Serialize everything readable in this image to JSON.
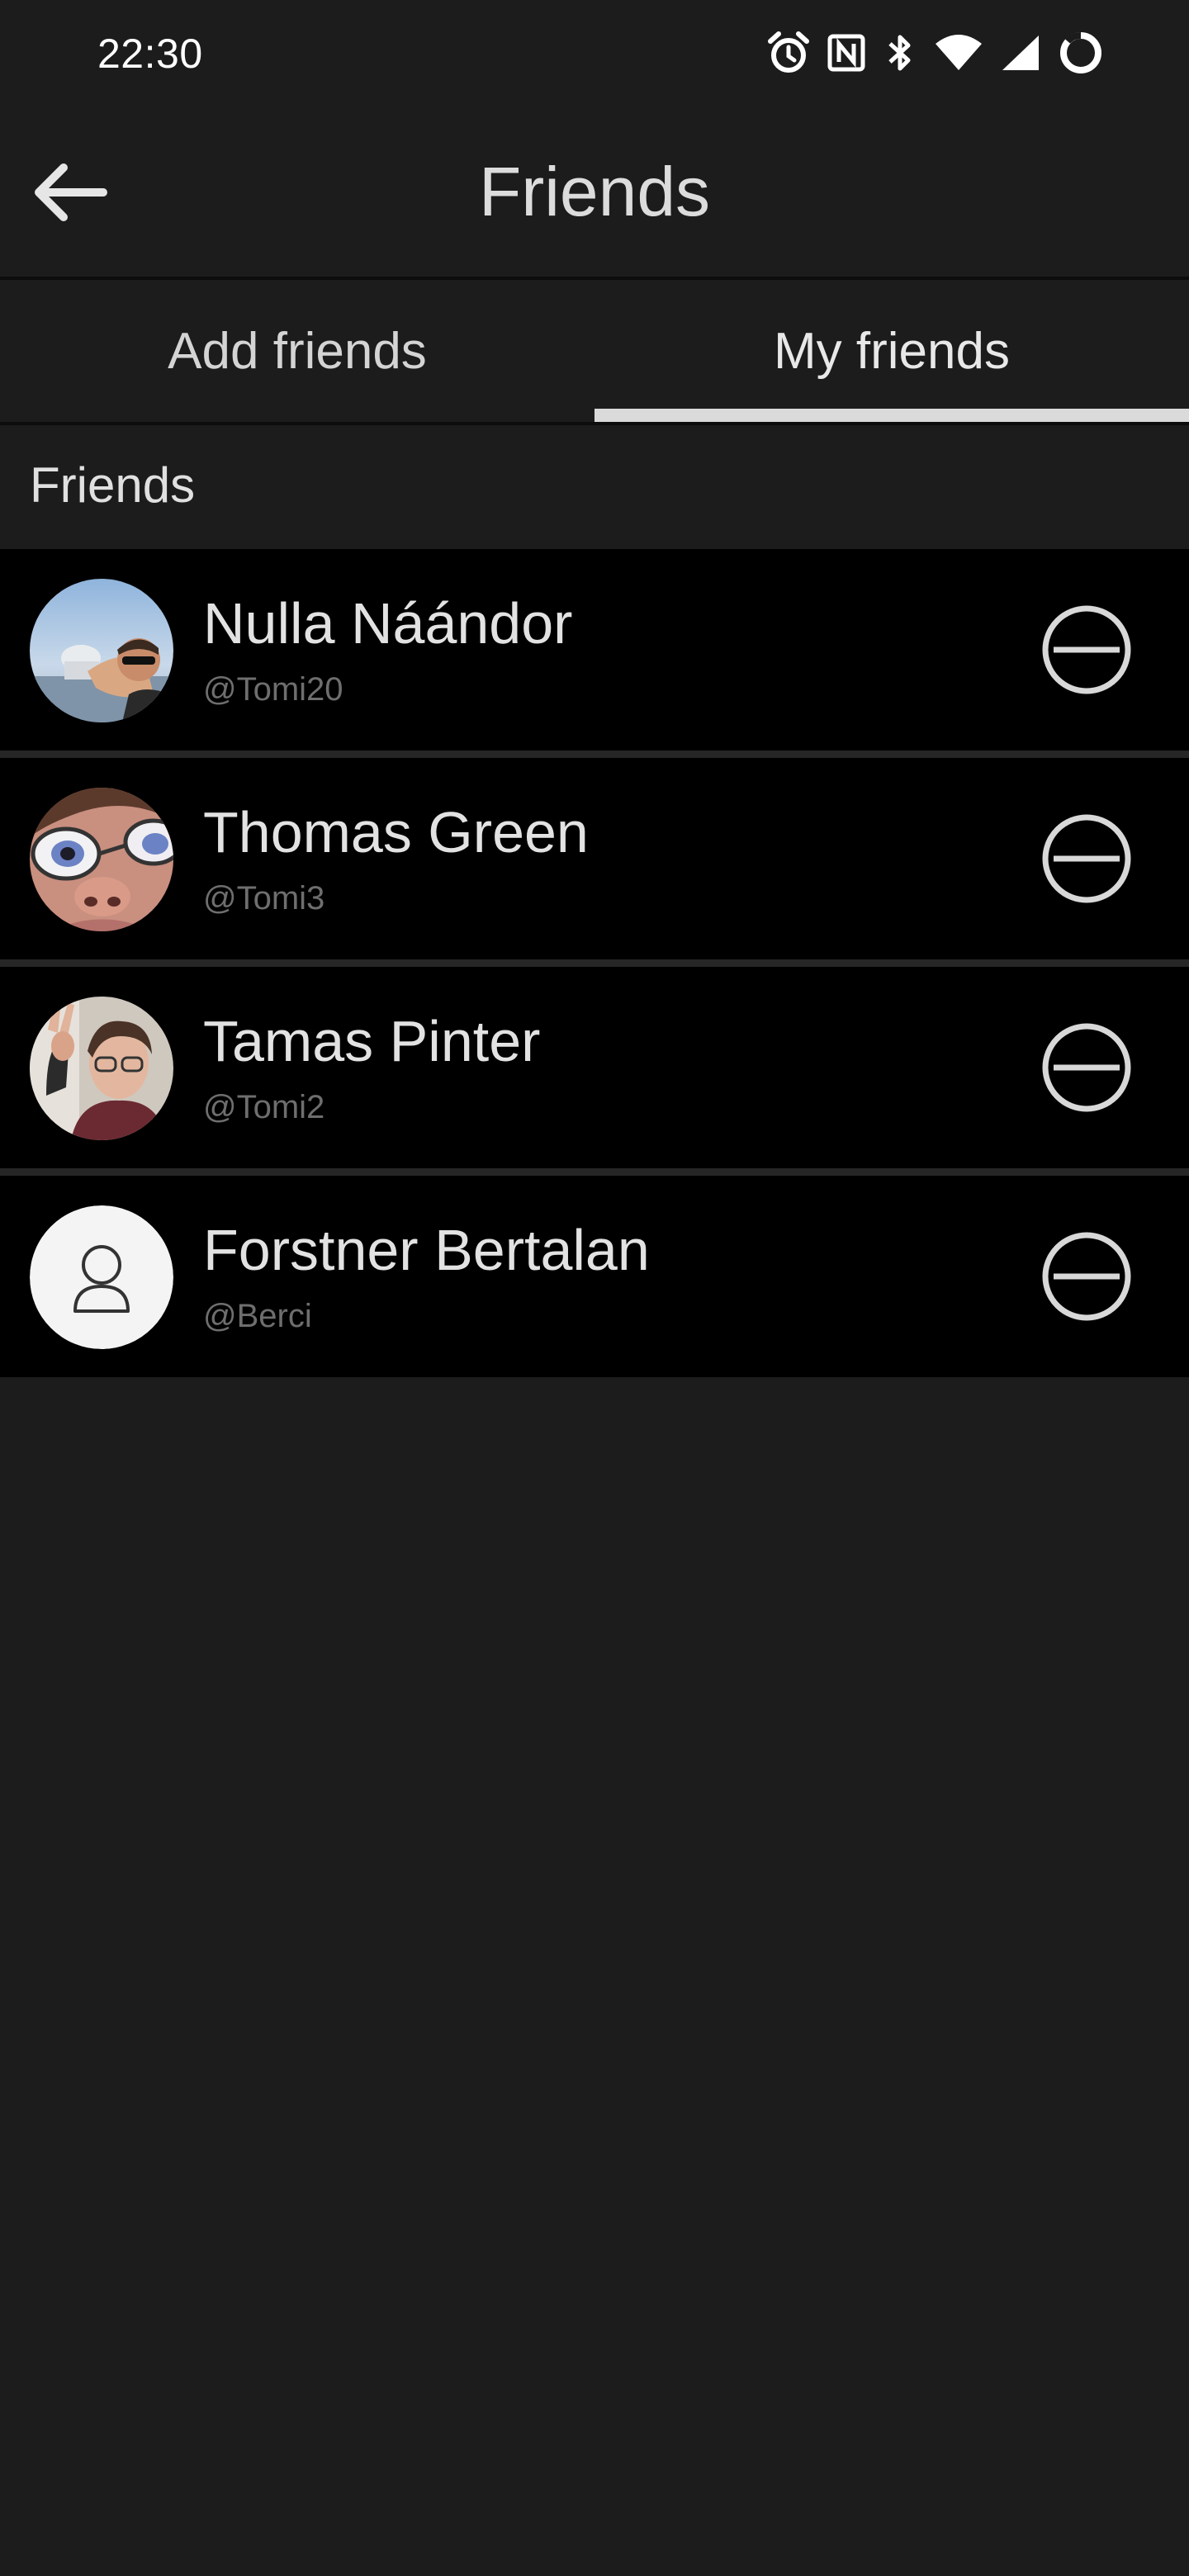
{
  "status_bar": {
    "time": "22:30",
    "icons": [
      "alarm-icon",
      "nfc-icon",
      "bluetooth-icon",
      "wifi-icon",
      "cell-signal-icon",
      "battery-icon"
    ]
  },
  "app_bar": {
    "title": "Friends",
    "back_icon": "arrow-left-icon"
  },
  "tabs": [
    {
      "label": "Add friends",
      "active": false
    },
    {
      "label": "My friends",
      "active": true
    }
  ],
  "section": {
    "title": "Friends"
  },
  "friends": [
    {
      "name": "Nulla Náándor",
      "handle": "@Tomi20",
      "avatar": "photo",
      "action_icon": "minus-circle-icon"
    },
    {
      "name": "Thomas Green",
      "handle": "@Tomi3",
      "avatar": "photo",
      "action_icon": "minus-circle-icon"
    },
    {
      "name": "Tamas Pinter",
      "handle": "@Tomi2",
      "avatar": "photo",
      "action_icon": "minus-circle-icon"
    },
    {
      "name": "Forstner Bertalan",
      "handle": "@Berci",
      "avatar": "placeholder-person-icon",
      "action_icon": "minus-circle-icon"
    }
  ],
  "colors": {
    "background": "#1c1c1c",
    "row_background": "#000000",
    "separator": "#262626",
    "text_primary": "#e2e2e2",
    "text_secondary": "#6e6e6e",
    "tab_indicator": "#dadada"
  }
}
